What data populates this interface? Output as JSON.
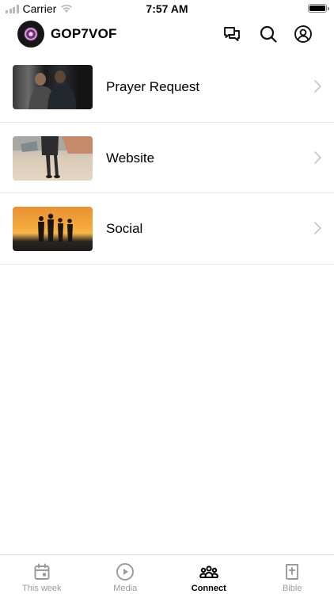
{
  "status_bar": {
    "carrier": "Carrier",
    "time": "7:57 AM"
  },
  "header": {
    "app_title": "GOP7VOF",
    "icons": [
      "chat-icon",
      "search-icon",
      "profile-icon"
    ]
  },
  "connect_items": [
    {
      "label": "Prayer Request",
      "thumbnail": "people-praying-photo"
    },
    {
      "label": "Website",
      "thumbnail": "person-walking-photo"
    },
    {
      "label": "Social",
      "thumbnail": "sunset-silhouettes-photo"
    }
  ],
  "tab_bar": {
    "tabs": [
      {
        "label": "This week",
        "icon": "calendar-icon",
        "active": false
      },
      {
        "label": "Media",
        "icon": "play-circle-icon",
        "active": false
      },
      {
        "label": "Connect",
        "icon": "people-group-icon",
        "active": true
      },
      {
        "label": "Bible",
        "icon": "bible-icon",
        "active": false
      }
    ]
  },
  "colors": {
    "active_tab": "#000000",
    "inactive_tab": "#9a9a9a",
    "divider": "#e6e6e6"
  }
}
